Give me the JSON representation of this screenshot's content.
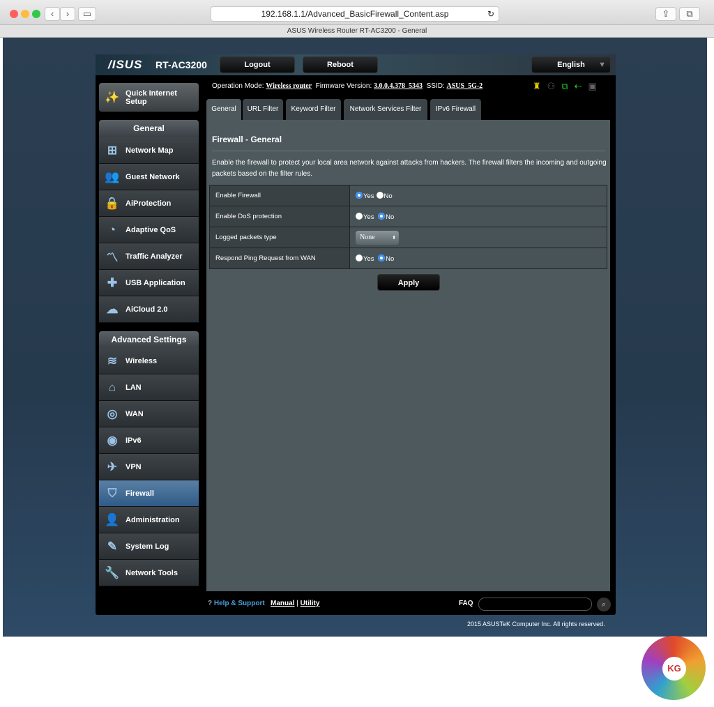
{
  "browser": {
    "url": "192.168.1.1/Advanced_BasicFirewall_Content.asp",
    "title": "ASUS Wireless Router RT-AC3200 - General"
  },
  "header": {
    "brand": "/ISUS",
    "model": "RT-AC3200",
    "logout": "Logout",
    "reboot": "Reboot",
    "language": "English"
  },
  "status": {
    "op_label": "Operation Mode:",
    "op_value": "Wireless router",
    "fw_label": "Firmware Version:",
    "fw_value": "3.0.0.4.378_5343",
    "ssid_label": "SSID:",
    "ssid_value": "ASUS_5G-2"
  },
  "sidebar": {
    "quick": "Quick Internet Setup",
    "general_header": "General",
    "general": [
      {
        "label": "Network Map",
        "icon": "⊞"
      },
      {
        "label": "Guest Network",
        "icon": "👥"
      },
      {
        "label": "AiProtection",
        "icon": "🔒"
      },
      {
        "label": "Adaptive QoS",
        "icon": "◔"
      },
      {
        "label": "Traffic Analyzer",
        "icon": "〽"
      },
      {
        "label": "USB Application",
        "icon": "✚"
      },
      {
        "label": "AiCloud 2.0",
        "icon": "☁"
      }
    ],
    "advanced_header": "Advanced Settings",
    "advanced": [
      {
        "label": "Wireless",
        "icon": "≋"
      },
      {
        "label": "LAN",
        "icon": "⌂"
      },
      {
        "label": "WAN",
        "icon": "◎"
      },
      {
        "label": "IPv6",
        "icon": "◉"
      },
      {
        "label": "VPN",
        "icon": "✈"
      },
      {
        "label": "Firewall",
        "icon": "⛉"
      },
      {
        "label": "Administration",
        "icon": "👤"
      },
      {
        "label": "System Log",
        "icon": "✎"
      },
      {
        "label": "Network Tools",
        "icon": "🔧"
      }
    ]
  },
  "tabs": [
    "General",
    "URL Filter",
    "Keyword Filter",
    "Network Services Filter",
    "IPv6 Firewall"
  ],
  "main": {
    "title": "Firewall - General",
    "description": "Enable the firewall to protect your local area network against attacks from hackers. The firewall filters the incoming and outgoing packets based on the filter rules.",
    "rows": [
      {
        "label": "Enable Firewall",
        "value": "Yes"
      },
      {
        "label": "Enable DoS protection",
        "value": "No"
      },
      {
        "label": "Logged packets type",
        "select": "None"
      },
      {
        "label": "Respond Ping Request from WAN",
        "value": "No"
      }
    ],
    "yes": "Yes",
    "no": "No",
    "apply": "Apply"
  },
  "footer": {
    "help": "Help & Support",
    "manual": "Manual",
    "sep": "|",
    "utility": "Utility",
    "faq": "FAQ",
    "copyright": "2015 ASUSTeK Computer Inc. All rights reserved."
  },
  "watermark": "KG"
}
